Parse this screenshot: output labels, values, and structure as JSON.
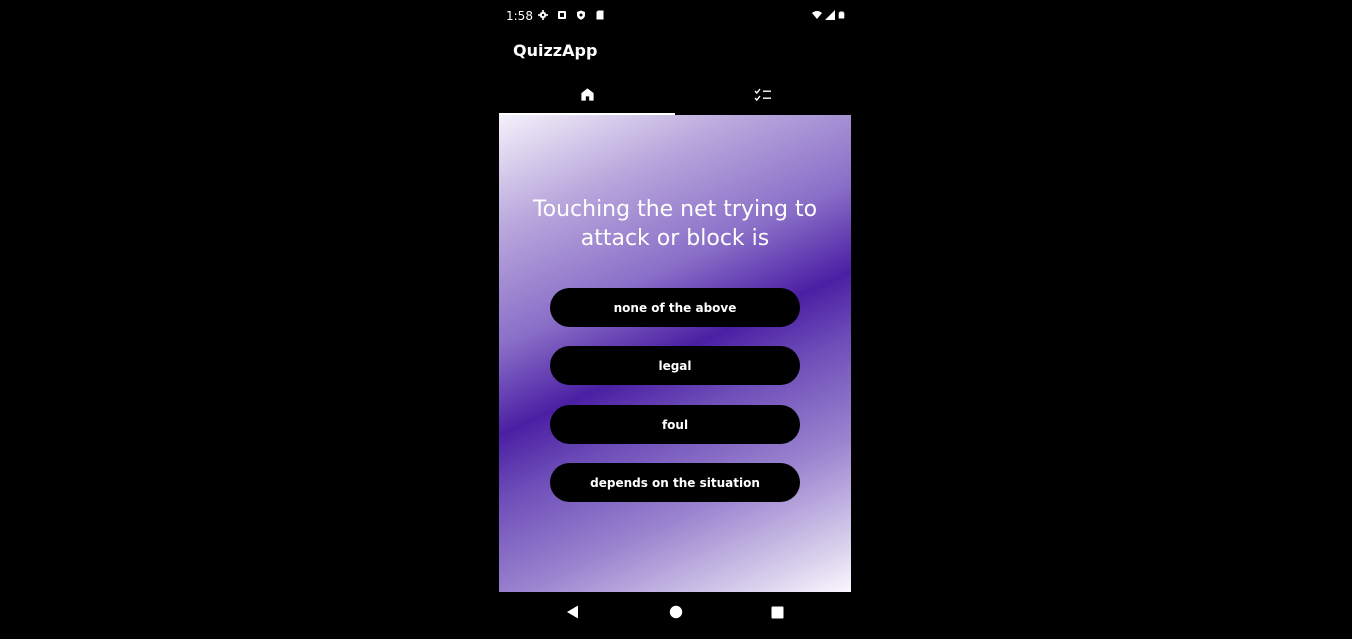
{
  "status_bar": {
    "time": "1:58",
    "left_icons": [
      "gear-icon",
      "android-icon",
      "shield-icon",
      "sd-card-icon"
    ],
    "right_icons": [
      "wifi-icon",
      "signal-icon",
      "battery-icon"
    ]
  },
  "app_bar": {
    "title": "QuizzApp"
  },
  "tabs": [
    {
      "icon": "home-icon",
      "active": true
    },
    {
      "icon": "checklist-icon",
      "active": false
    }
  ],
  "quiz": {
    "question": "Touching the net trying to attack or block is",
    "answers": [
      "none of the above",
      "legal",
      "foul",
      "depends on the situation"
    ]
  },
  "nav_bar": {
    "buttons": [
      "back-icon",
      "home-circle-icon",
      "recents-icon"
    ]
  },
  "colors": {
    "background": "#000000",
    "gradient_mid": "#4b1fa3",
    "gradient_light": "#f4f1fa",
    "answer_button": "#000000",
    "text": "#ffffff"
  }
}
